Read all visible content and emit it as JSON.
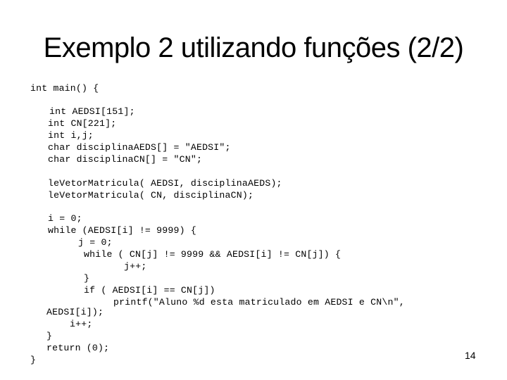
{
  "slide": {
    "title": "Exemplo 2 utilizando funções (2/2)",
    "page_number": "14",
    "code": {
      "lines": [
        "int main() {",
        "int AEDSI[151];",
        "int CN[221];",
        "int i,j;",
        "char disciplinaAEDS[] = \"AEDSI\";",
        "char disciplinaCN[] = \"CN\";",
        "leVetorMatricula( AEDSI, disciplinaAEDS);",
        "leVetorMatricula( CN, disciplinaCN);",
        "i = 0;",
        "while (AEDSI[i] != 9999) {",
        "j = 0;",
        "while ( CN[j] != 9999 && AEDSI[i] != CN[j]) {",
        "j++;",
        "}",
        "if ( AEDSI[i] == CN[j])",
        "printf(\"Aluno %d esta matriculado em AEDSI e CN\\n\",",
        "AEDSI[i]);",
        "i++;",
        "}",
        "return (0);",
        "}"
      ]
    }
  }
}
